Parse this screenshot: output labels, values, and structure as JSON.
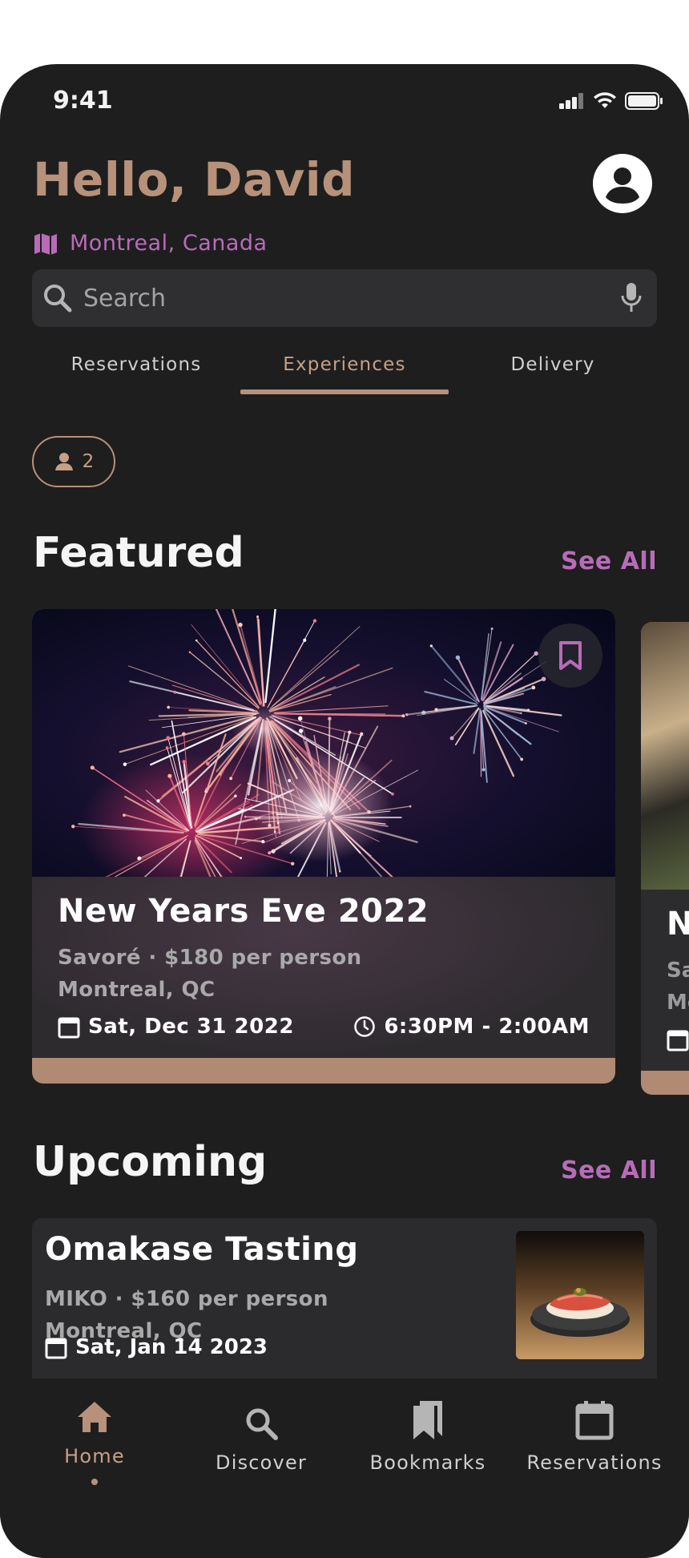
{
  "status_bar": {
    "time": "9:41"
  },
  "header": {
    "greeting": "Hello, David",
    "location": "Montreal, Canada"
  },
  "search": {
    "placeholder": "Search"
  },
  "tabs": [
    {
      "label": "Reservations",
      "active": false
    },
    {
      "label": "Experiences",
      "active": true
    },
    {
      "label": "Delivery",
      "active": false
    }
  ],
  "guest_filter": {
    "count": "2"
  },
  "featured": {
    "title": "Featured",
    "see_all": "See All",
    "cards": [
      {
        "title": "New Years Eve 2022",
        "subtitle": "Savoré · $180 per person",
        "location": "Montreal, QC",
        "date": "Sat, Dec 31 2022",
        "time": "6:30PM - 2:00AM"
      },
      {
        "title": "N",
        "subtitle": "Sa",
        "location": "Mo"
      }
    ]
  },
  "upcoming": {
    "title": "Upcoming",
    "see_all": "See All",
    "items": [
      {
        "title": "Omakase Tasting",
        "subtitle": "MIKO · $160 per person",
        "location": "Montreal, QC",
        "date": "Sat, Jan 14 2023"
      }
    ]
  },
  "bottom_nav": [
    {
      "label": "Home",
      "icon": "home-icon",
      "active": true
    },
    {
      "label": "Discover",
      "icon": "search-icon",
      "active": false
    },
    {
      "label": "Bookmarks",
      "icon": "bookmarks-icon",
      "active": false
    },
    {
      "label": "Reservations",
      "icon": "calendar-icon",
      "active": false
    }
  ],
  "colors": {
    "background": "#1e1e1f",
    "accent": "#b7917a",
    "highlight": "#b86cb8",
    "surface": "#2f2f31"
  }
}
